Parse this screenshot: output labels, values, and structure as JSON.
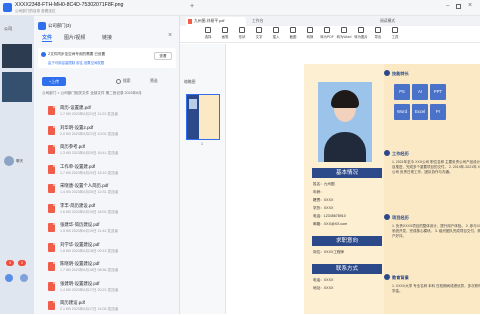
{
  "titlebar": {
    "title": "XXXX2348-FTH-MH0-8C4D-75302071F8F.png",
    "subtitle": "公司部门的目录  查看定位"
  },
  "leftchat": {
    "top_label": "公司",
    "items": [
      "2/",
      "日",
      "回"
    ],
    "chat_preview": "聊天",
    "counts": [
      "3",
      "2"
    ],
    "bottom_labels": [
      "联系人",
      "设置"
    ]
  },
  "filepanel": {
    "header": "公司部门(3)",
    "tabs": [
      "文件",
      "图片/视频",
      "链接"
    ],
    "notice": "Z文件同步至空间专用的需要 已设置",
    "notice_btn": "查看",
    "notice2": "由于可用容量限制 前往 设置空间权限",
    "upload_btn": "+上传",
    "search_label": "搜索",
    "filter": "筛选",
    "path": "公司部门 > 公司部门相关文件   全部文件  第二批记录  2023年6月",
    "files": [
      {
        "name": "简历-设置建.pdf",
        "meta": "1.7 KB  2023年6月21日 11:23 发送者"
      },
      {
        "name": "刘华明-设置2.pdf",
        "meta": "2.0 KB  2023年6月21日 10:02 发送者"
      },
      {
        "name": "简历参考.pdf",
        "meta": "1.3 KB  2023年6月20日 16:41 发送者"
      },
      {
        "name": "工作单-设置建.pdf",
        "meta": "1.7 KB  2023年6月20日 15:10 发送者"
      },
      {
        "name": "宋晓唐-设置个人简历.pdf",
        "meta": "1.4 KB  2023年6月20日 12:31 发送者"
      },
      {
        "name": "李丰-简历建设.pdf",
        "meta": "1.6 KB  2023年6月19日 18:02 发送者"
      },
      {
        "name": "张建华-简历建设.pdf",
        "meta": "1.5 KB  2023年6月19日 11:44 发送者"
      },
      {
        "name": "刘学华-设置建设.pdf",
        "meta": "1.8 KB  2023年6月18日 09:13 发送者"
      },
      {
        "name": "陈晓明-设置建设.pdf",
        "meta": "1.7 KB  2023年6月18日 08:56 发送者"
      },
      {
        "name": "张建明-设置建设.pdf",
        "meta": "1.4 KB  2023年6月17日 20:22 发送者"
      },
      {
        "name": "简历建设.pdf",
        "meta": "2.1 KB  2023年6月17日 14:05 发送者"
      }
    ]
  },
  "pdf": {
    "tab_title": "九州图-刘易平.pdf",
    "new_tab": "工作台",
    "app_label": "某某软件",
    "mode": "阅读模式",
    "filename": "九州图-刘易平.pdf",
    "tools": [
      "选择",
      "画笔",
      "形状",
      "文字",
      "插入",
      "截图",
      "转换",
      "转为PDF",
      "转为Word",
      "转为图片",
      "导出",
      "工具"
    ],
    "thumb_label": "缩略图",
    "page_num": "1",
    "resume": {
      "sec1": "基本情况",
      "info": [
        "姓名：九州图",
        "年龄：",
        "籍贯：XXXX",
        "学历：XXXX",
        "电话：12345678910",
        "邮箱：XXX@XX.com"
      ],
      "sec2": "求职意向",
      "intent": [
        "岗位：XXXX工程师"
      ],
      "sec3": "联系方式",
      "contact": [
        "电话：XXXX",
        "地址：XXXX"
      ],
      "skill_title": "技能特长",
      "skills": [
        "PS",
        "AI",
        "PPT",
        "Word",
        "Excel",
        "Pr"
      ],
      "work_title": "工作经历",
      "work_text": "1. 2021年至今 XXX公司 职位名称  主要负责公司产品设计与项目推进，完成多个重要项目的交付。 2. 2019年-2021年 XXX公司  负责日常工作，团队协作与沟通。",
      "proj_title": "项目经历",
      "proj_text": "1. 负责XXXX项目的整体设计，提升用户体验。 2. 参与XXXX系统开发，完成核心模块。 3. 组织团队完成项目交付，获得客户好评。",
      "edu_title": "教育背景",
      "edu_text": "1. XXXX大学 专业名称 本科  在校期间成绩优异，多次获得奖学金。"
    }
  },
  "colors": {
    "accent": "#2f6fed",
    "navy": "#2c4a8a",
    "paper": "#fbe9c5"
  }
}
